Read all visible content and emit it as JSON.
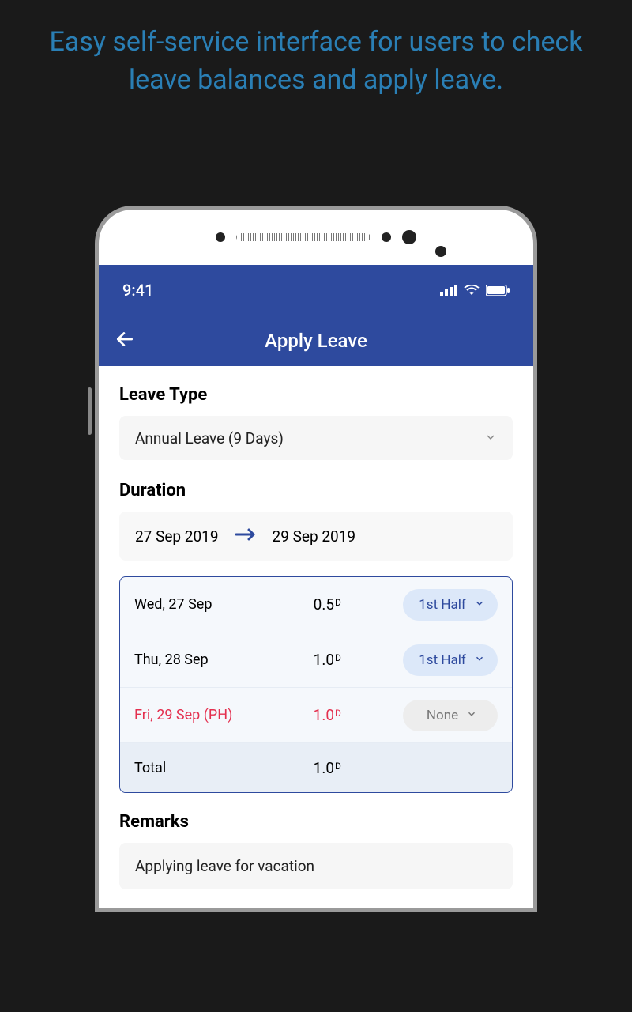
{
  "promo": "Easy self-service interface for users to check leave balances and apply leave.",
  "status": {
    "time": "9:41"
  },
  "nav": {
    "title": "Apply Leave"
  },
  "leaveType": {
    "label": "Leave Type",
    "selected": "Annual Leave (9 Days)"
  },
  "duration": {
    "label": "Duration",
    "from": "27 Sep 2019",
    "to": "29 Sep 2019",
    "days": [
      {
        "label": "Wed, 27 Sep",
        "amount": "0.5",
        "unit": "D",
        "half": "1st Half",
        "holiday": false,
        "enabled": true
      },
      {
        "label": "Thu, 28 Sep",
        "amount": "1.0",
        "unit": "D",
        "half": "1st Half",
        "holiday": false,
        "enabled": true
      },
      {
        "label": "Fri, 29 Sep (PH)",
        "amount": "1.0",
        "unit": "D",
        "half": "None",
        "holiday": true,
        "enabled": false
      }
    ],
    "totalLabel": "Total",
    "totalAmount": "1.0",
    "totalUnit": "D"
  },
  "remarks": {
    "label": "Remarks",
    "value": "Applying leave for vacation"
  }
}
